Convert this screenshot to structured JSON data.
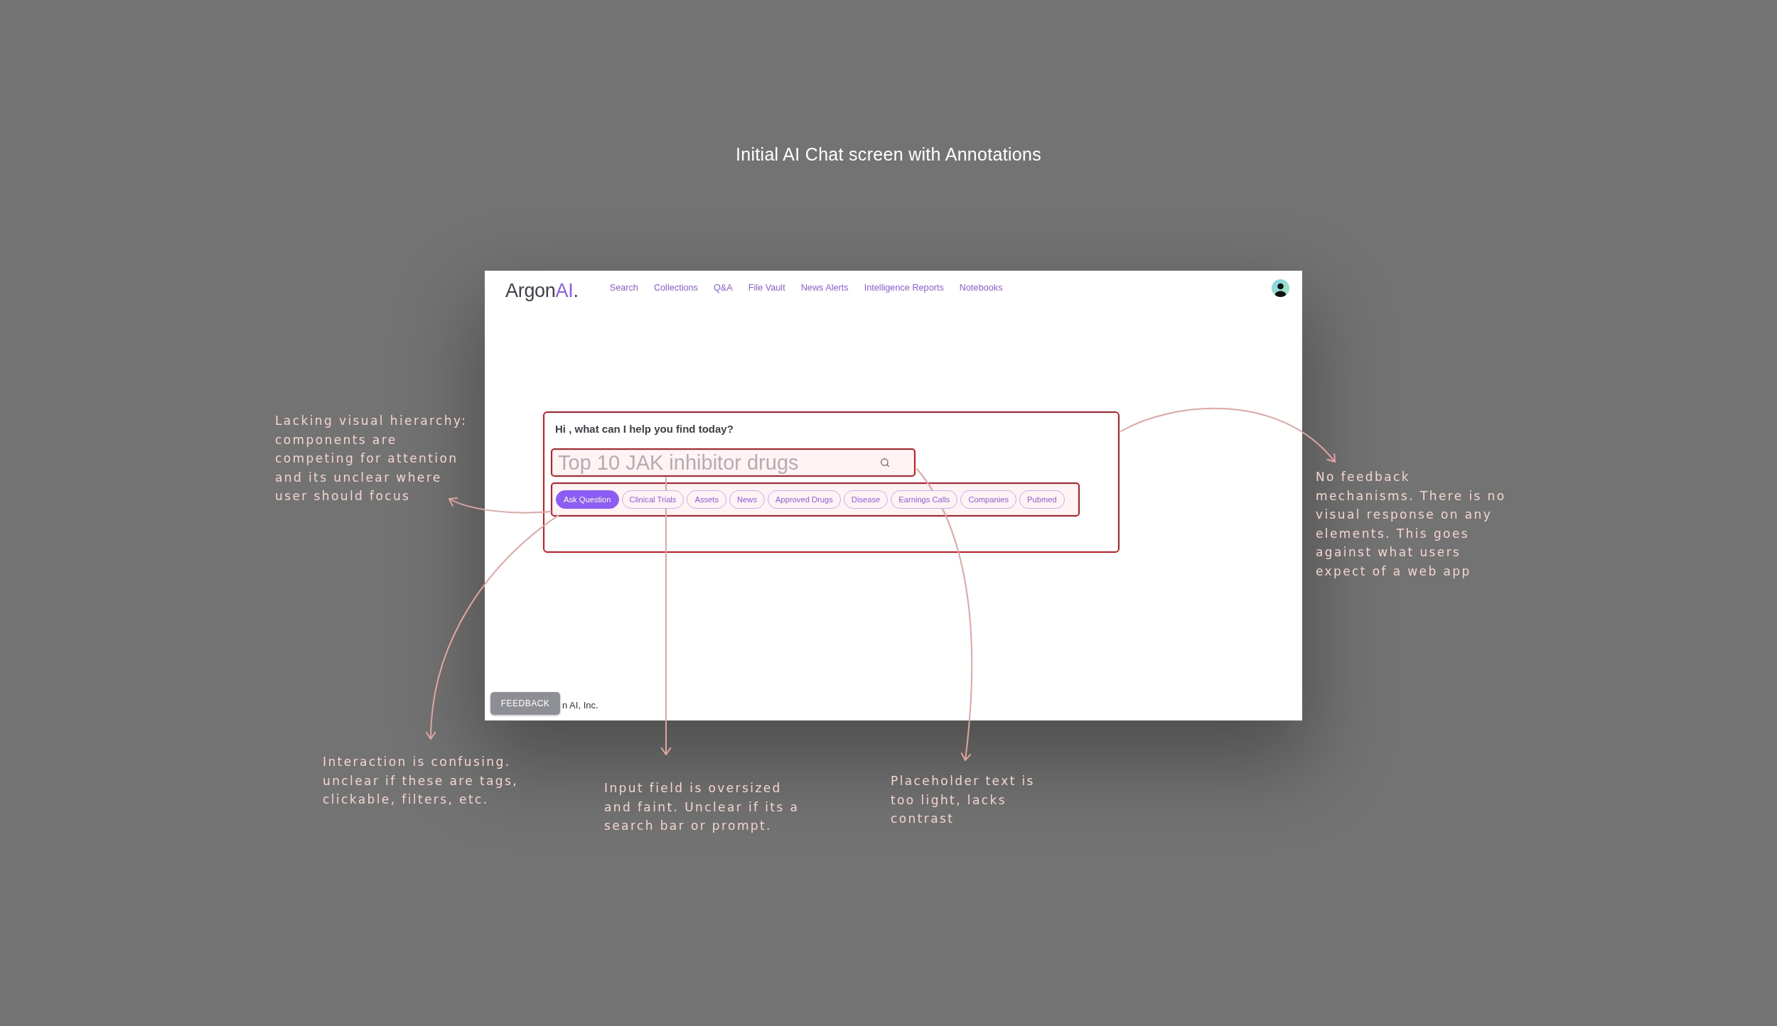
{
  "page": {
    "title": "Initial AI Chat screen with Annotations"
  },
  "app": {
    "logo": [
      {
        "text": "Argon",
        "accent": false
      },
      {
        "text": "AI",
        "accent": true
      },
      {
        "text": ".",
        "accent": false
      }
    ],
    "nav": [
      "Search",
      "Collections",
      "Q&A",
      "File Vault",
      "News Alerts",
      "Intelligence Reports",
      "Notebooks"
    ],
    "prompt": {
      "greeting": "Hi , what can I help you find today?",
      "search": {
        "placeholder": "Top 10 JAK inhibitor drugs"
      },
      "chips": [
        {
          "label": "Ask Question",
          "selected": true
        },
        {
          "label": "Clinical Trials",
          "selected": false
        },
        {
          "label": "Assets",
          "selected": false
        },
        {
          "label": "News",
          "selected": false
        },
        {
          "label": "Approved Drugs",
          "selected": false
        },
        {
          "label": "Disease",
          "selected": false
        },
        {
          "label": "Earnings Calls",
          "selected": false
        },
        {
          "label": "Companies",
          "selected": false
        },
        {
          "label": "Pubmed",
          "selected": false
        }
      ]
    },
    "footer": {
      "feedback_button": "FEEDBACK",
      "text": "n AI, Inc."
    }
  },
  "annotations": [
    {
      "lines": [
        "Lacking visual hierarchy:",
        "components are",
        "competing for attention",
        "and its unclear where",
        "user should focus"
      ]
    },
    {
      "lines": [
        "No feedback",
        "mechanisms. There is no",
        "visual response on any",
        "elements. This goes",
        "against what users",
        "expect of a web app"
      ]
    },
    {
      "lines": [
        "Interaction is confusing.",
        "unclear if these are tags,",
        "clickable, filters, etc."
      ]
    },
    {
      "lines": [
        "Input field is oversized",
        "and faint. Unclear if its a",
        "search bar or prompt."
      ]
    },
    {
      "lines": [
        "Placeholder text is",
        "too light, lacks",
        "contrast"
      ]
    }
  ]
}
